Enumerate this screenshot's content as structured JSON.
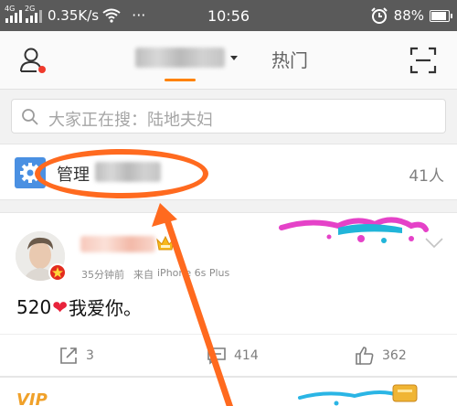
{
  "status_bar": {
    "signal1_label": "4G",
    "signal2_label": "2G",
    "network_speed": "0.35K/s",
    "more": "···",
    "time": "10:56",
    "battery": "88%",
    "battery_level": 0.88
  },
  "header": {
    "tab_hot": "热门"
  },
  "search": {
    "placeholder": "大家正在搜：陆地夫妇"
  },
  "group": {
    "label": "管理",
    "member_count": "41人"
  },
  "post": {
    "time_ago": "35分钟前",
    "source_prefix": "来自",
    "source": "iPhone 6s Plus",
    "text_prefix": "520",
    "text_suffix": "我爱你。",
    "reposts": "3",
    "comments": "414",
    "likes": "362"
  },
  "next_post": {
    "badge": "VIP"
  },
  "colors": {
    "accent": "#ff8200",
    "annotation": "#ff6a1f",
    "group_icon": "#4a90e2",
    "heart": "#e8233b"
  }
}
